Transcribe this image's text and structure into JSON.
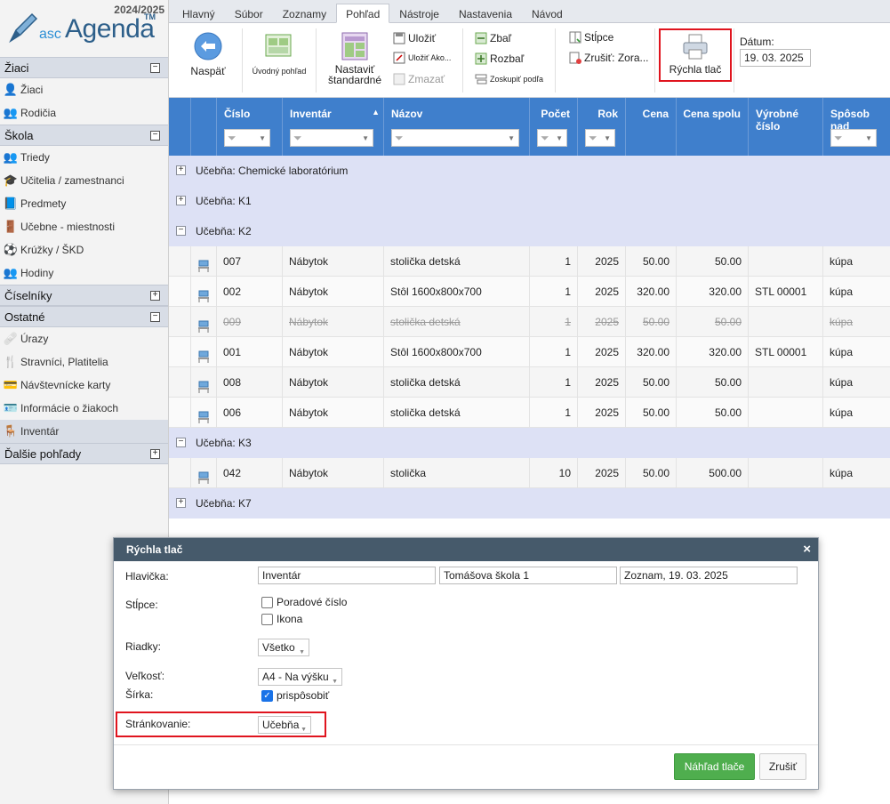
{
  "app": {
    "year": "2024/2025",
    "logo_prefix": "asc",
    "logo_name": "Agenda",
    "logo_tm": "TM"
  },
  "sidebar": {
    "sections": [
      {
        "title": "Žiaci",
        "toggle": "−",
        "items": [
          {
            "label": "Žiaci",
            "icon": "student-icon"
          },
          {
            "label": "Rodičia",
            "icon": "parents-icon"
          }
        ]
      },
      {
        "title": "Škola",
        "toggle": "−",
        "items": [
          {
            "label": "Triedy",
            "icon": "class-icon"
          },
          {
            "label": "Učitelia / zamestnanci",
            "icon": "graduation-cap-icon"
          },
          {
            "label": "Predmety",
            "icon": "book-icon"
          },
          {
            "label": "Učebne - miestnosti",
            "icon": "door-icon"
          },
          {
            "label": "Krúžky / ŠKD",
            "icon": "club-icon"
          },
          {
            "label": "Hodiny",
            "icon": "lessons-icon"
          }
        ]
      },
      {
        "title": "Číselníky",
        "toggle": "+",
        "items": []
      },
      {
        "title": "Ostatné",
        "toggle": "−",
        "items": [
          {
            "label": "Úrazy",
            "icon": "injury-icon"
          },
          {
            "label": "Stravníci, Platitelia",
            "icon": "diner-icon"
          },
          {
            "label": "Návštevnícke karty",
            "icon": "card-icon"
          },
          {
            "label": "Informácie o žiakoch",
            "icon": "id-card-icon"
          },
          {
            "label": "Inventár",
            "icon": "desk-icon",
            "active": true
          }
        ]
      },
      {
        "title": "Ďalšie pohľady",
        "toggle": "+",
        "items": []
      }
    ]
  },
  "tabs": [
    "Hlavný",
    "Súbor",
    "Zoznamy",
    "Pohľad",
    "Nástroje",
    "Nastavenia",
    "Návod"
  ],
  "active_tab": "Pohľad",
  "ribbon": {
    "back": "Naspäť",
    "home_view": "Úvodný pohľad",
    "set_default_1": "Nastaviť",
    "set_default_2": "štandardné",
    "save": "Uložiť",
    "save_as": "Uložiť Ako...",
    "delete": "Zmazať",
    "collapse": "Zbaľ",
    "expand": "Rozbaľ",
    "group_by": "Zoskupiť podľa",
    "columns": "Stĺpce",
    "cancel_sort": "Zrušiť: Zora...",
    "quick_print": "Rýchla tlač",
    "date_label": "Dátum:",
    "date_value": "19. 03. 2025"
  },
  "grid": {
    "columns": [
      "",
      "",
      "Číslo",
      "Inventár",
      "Názov",
      "Počet",
      "Rok",
      "Cena",
      "Cena spolu",
      "Výrobné číslo",
      "Spôsob nad"
    ],
    "sort_indicator": "▲",
    "groups": [
      {
        "label": "Učebňa: Chemické laboratórium",
        "toggle": "+",
        "rows": []
      },
      {
        "label": "Učebňa: K1",
        "toggle": "+",
        "rows": []
      },
      {
        "label": "Učebňa: K2",
        "toggle": "−",
        "rows": [
          {
            "cislo": "007",
            "inventar": "Nábytok",
            "nazov": "stolička detská",
            "pocet": "1",
            "rok": "2025",
            "cena": "50.00",
            "spolu": "50.00",
            "vyrobne": "",
            "sposob": "kúpa",
            "strike": false
          },
          {
            "cislo": "002",
            "inventar": "Nábytok",
            "nazov": "Stôl 1600x800x700",
            "pocet": "1",
            "rok": "2025",
            "cena": "320.00",
            "spolu": "320.00",
            "vyrobne": "STL 00001",
            "sposob": "kúpa",
            "strike": false
          },
          {
            "cislo": "009",
            "inventar": "Nábytok",
            "nazov": "stolička detská",
            "pocet": "1",
            "rok": "2025",
            "cena": "50.00",
            "spolu": "50.00",
            "vyrobne": "",
            "sposob": "kúpa",
            "strike": true
          },
          {
            "cislo": "001",
            "inventar": "Nábytok",
            "nazov": "Stôl 1600x800x700",
            "pocet": "1",
            "rok": "2025",
            "cena": "320.00",
            "spolu": "320.00",
            "vyrobne": "STL 00001",
            "sposob": "kúpa",
            "strike": false
          },
          {
            "cislo": "008",
            "inventar": "Nábytok",
            "nazov": "stolička detská",
            "pocet": "1",
            "rok": "2025",
            "cena": "50.00",
            "spolu": "50.00",
            "vyrobne": "",
            "sposob": "kúpa",
            "strike": false
          },
          {
            "cislo": "006",
            "inventar": "Nábytok",
            "nazov": "stolička detská",
            "pocet": "1",
            "rok": "2025",
            "cena": "50.00",
            "spolu": "50.00",
            "vyrobne": "",
            "sposob": "kúpa",
            "strike": false
          }
        ]
      },
      {
        "label": "Učebňa: K3",
        "toggle": "−",
        "rows": [
          {
            "cislo": "042",
            "inventar": "Nábytok",
            "nazov": "stolička",
            "pocet": "10",
            "rok": "2025",
            "cena": "50.00",
            "spolu": "500.00",
            "vyrobne": "",
            "sposob": "kúpa",
            "strike": false
          }
        ]
      },
      {
        "label": "Učebňa: K7",
        "toggle": "+",
        "rows": []
      }
    ]
  },
  "dialog": {
    "title": "Rýchla tlač",
    "close": "×",
    "header_label": "Hlavička:",
    "header_values": [
      "Inventár",
      "Tomášova škola 1",
      "Zoznam, 19. 03. 2025"
    ],
    "columns_label": "Stĺpce:",
    "col_options": [
      {
        "label": "Poradové číslo",
        "checked": false
      },
      {
        "label": "Ikona",
        "checked": false
      }
    ],
    "rows_label": "Riadky:",
    "rows_value": "Všetko",
    "size_label": "Veľkosť:",
    "size_value": "A4 - Na výšku",
    "width_label": "Šírka:",
    "width_option": "prispôsobiť",
    "width_checked": true,
    "paging_label": "Stránkovanie:",
    "paging_value": "Učebňa",
    "preview_btn": "Náhľad tlače",
    "cancel_btn": "Zrušiť"
  },
  "colors": {
    "header_blue": "#3f7fcc",
    "group_bg": "#dde1f5",
    "dialog_title": "#465a6b",
    "preview_green": "#4fae4e",
    "highlight_red": "#e0141e"
  }
}
